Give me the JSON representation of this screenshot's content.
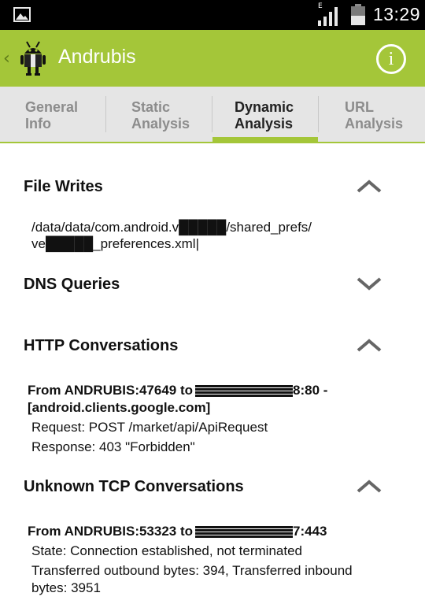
{
  "status_bar": {
    "time": "13:29",
    "network_type": "E",
    "icons": {
      "left": "gallery-icon",
      "signal": "signal-icon",
      "battery": "battery-icon"
    }
  },
  "action_bar": {
    "title": "Andrubis",
    "info_label": "i",
    "up_glyph": "‹",
    "accent_color": "#a4c639"
  },
  "tabs": [
    {
      "line1": "General",
      "line2": "Info",
      "active": false
    },
    {
      "line1": "Static",
      "line2": "Analysis",
      "active": false
    },
    {
      "line1": "Dynamic",
      "line2": "Analysis",
      "active": true
    },
    {
      "line1": "URL",
      "line2": "Analysis",
      "active": false
    }
  ],
  "sections": {
    "file_writes": {
      "title": "File Writes",
      "expanded": true,
      "lines": [
        "/data/data/com.android.v█████/shared_prefs/",
        "ve█████_preferences.xml|"
      ]
    },
    "dns_queries": {
      "title": "DNS Queries",
      "expanded": false
    },
    "http_conversations": {
      "title": "HTTP Conversations",
      "expanded": true,
      "from_line_start": "From ANDRUBIS:47649 to ",
      "from_line_end": "8:80 -",
      "host_line": "[android.clients.google.com]",
      "request": "Request: POST /market/api/ApiRequest",
      "response": "Response: 403 \"Forbidden\""
    },
    "unknown_tcp": {
      "title": "Unknown TCP Conversations",
      "expanded": true,
      "from_line_start": "From ANDRUBIS:53323 to ",
      "from_line_end": "7:443",
      "state": "State: Connection established, not terminated",
      "transferred_1": "Transferred outbound bytes: 394, Transferred inbound",
      "transferred_2": "bytes: 3951"
    }
  }
}
